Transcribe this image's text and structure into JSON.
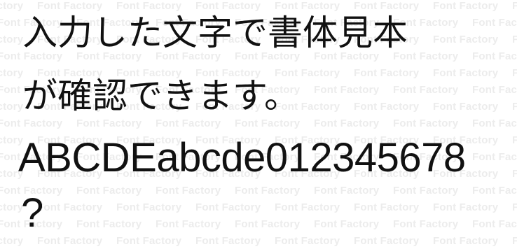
{
  "watermark": {
    "text": "Font Factory",
    "color": "#ececec"
  },
  "sample": {
    "lines": [
      "入力した文字で書体見本",
      "が確認できます。",
      "ABCDEabcde012345678",
      "?"
    ],
    "text_color": "#111111"
  }
}
